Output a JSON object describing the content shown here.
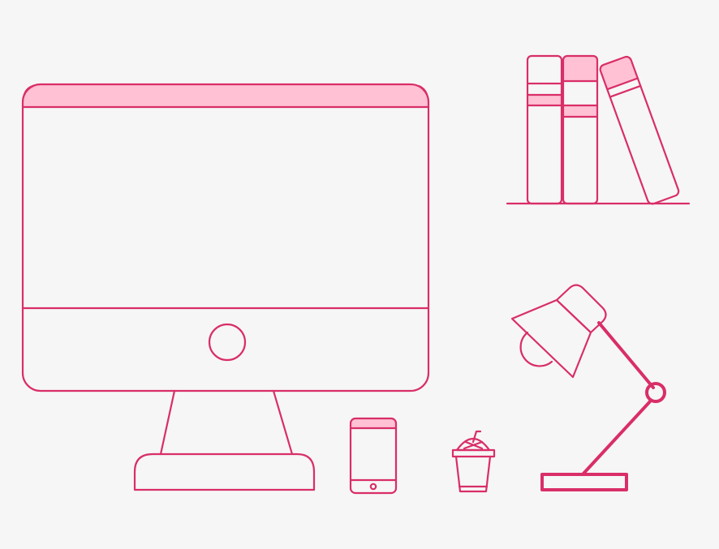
{
  "colors": {
    "background": "#f6f6f6",
    "stroke": "#d92e68",
    "fill": "#ffc1d3"
  },
  "icons": [
    "desktop-monitor-icon",
    "books-icon",
    "desk-lamp-icon",
    "smartphone-icon",
    "drink-cup-icon"
  ]
}
